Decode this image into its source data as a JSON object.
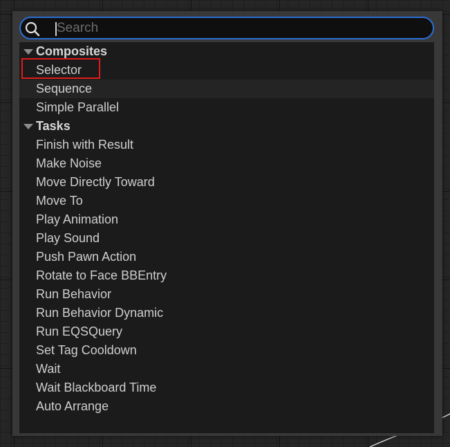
{
  "search": {
    "placeholder": "Search"
  },
  "categories": [
    {
      "label": "Composites",
      "items": [
        "Selector",
        "Sequence",
        "Simple Parallel"
      ]
    },
    {
      "label": "Tasks",
      "items": [
        "Finish with Result",
        "Make Noise",
        "Move Directly Toward",
        "Move To",
        "Play Animation",
        "Play Sound",
        "Push Pawn Action",
        "Rotate to Face BBEntry",
        "Run Behavior",
        "Run Behavior Dynamic",
        "Run EQSQuery",
        "Set Tag Cooldown",
        "Wait",
        "Wait Blackboard Time"
      ]
    }
  ],
  "footer_item": "Auto Arrange",
  "colors": {
    "search_border": "#2a6fd6",
    "highlight_box": "#e01b1b",
    "list_background": "#1b1b1b"
  },
  "icons": {
    "search": "magnifier-icon",
    "expanded": "triangle-down-icon"
  }
}
